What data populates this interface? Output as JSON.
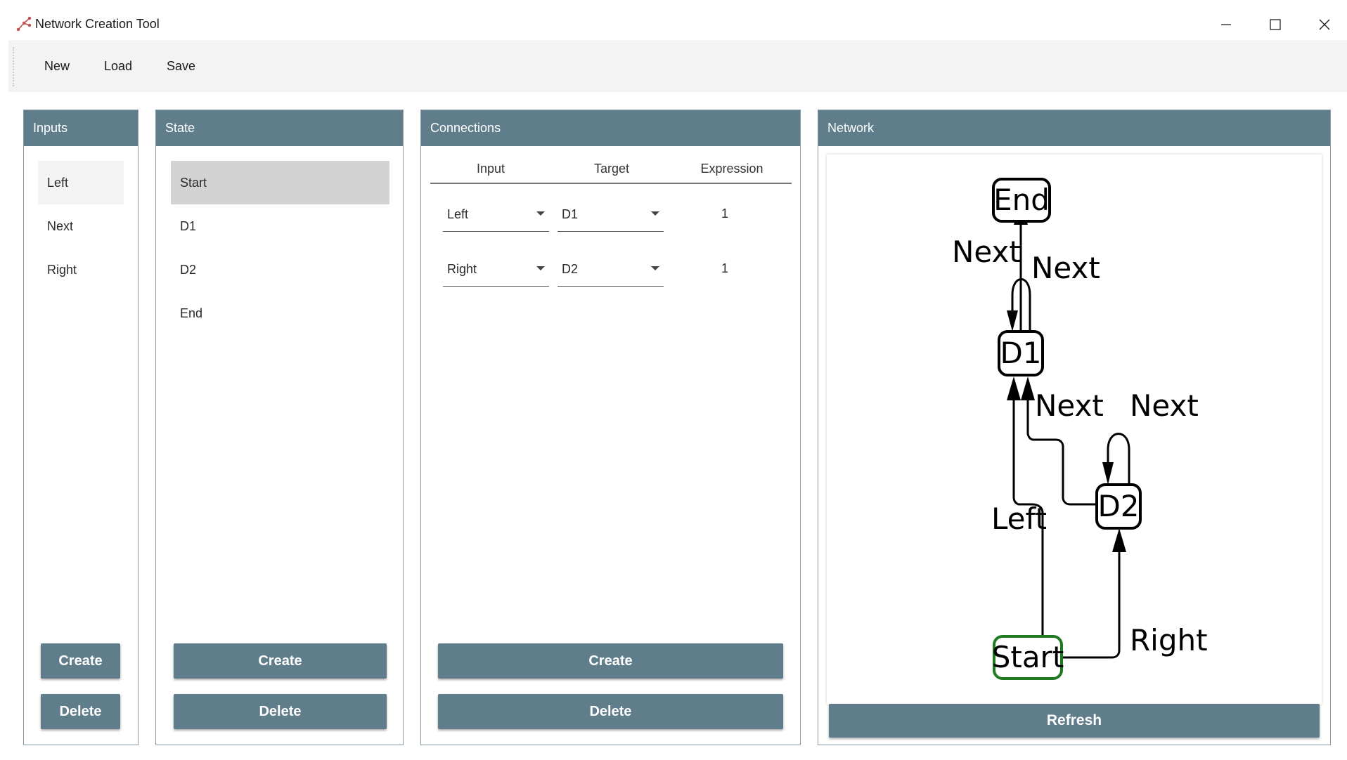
{
  "window": {
    "title": "Network Creation Tool",
    "app_icon": "network-icon",
    "controls": [
      "minimize-icon",
      "maximize-icon",
      "close-icon"
    ]
  },
  "menu": {
    "items": [
      "New",
      "Load",
      "Save"
    ]
  },
  "inputs_panel": {
    "title": "Inputs",
    "items": [
      "Left",
      "Next",
      "Right"
    ],
    "create_label": "Create",
    "delete_label": "Delete"
  },
  "state_panel": {
    "title": "State",
    "items": [
      "Start",
      "D1",
      "D2",
      "End"
    ],
    "selected": "Start",
    "create_label": "Create",
    "delete_label": "Delete"
  },
  "connections_panel": {
    "title": "Connections",
    "columns": [
      "Input",
      "Target",
      "Expression"
    ],
    "rows": [
      {
        "input": "Left",
        "target": "D1",
        "expression": "1"
      },
      {
        "input": "Right",
        "target": "D2",
        "expression": "1"
      }
    ],
    "create_label": "Create",
    "delete_label": "Delete"
  },
  "network_panel": {
    "title": "Network",
    "refresh_label": "Refresh",
    "graph": {
      "nodes": [
        {
          "id": "End",
          "label": "End"
        },
        {
          "id": "D1",
          "label": "D1"
        },
        {
          "id": "D2",
          "label": "D2"
        },
        {
          "id": "Start",
          "label": "Start",
          "initial": true
        }
      ],
      "edges": [
        {
          "from": "D1",
          "to": "End",
          "label": "Next"
        },
        {
          "from": "End",
          "to": "D1",
          "label": "Next"
        },
        {
          "from": "D2",
          "to": "D1",
          "label": "Next"
        },
        {
          "from": "D2",
          "to": "D2",
          "label": "Next"
        },
        {
          "from": "Start",
          "to": "D1",
          "label": "Left"
        },
        {
          "from": "Start",
          "to": "D2",
          "label": "Right"
        }
      ],
      "start_node_color": "#1f7a1f"
    }
  },
  "colors": {
    "accent": "#607d8b",
    "selected": "#d3d3d3"
  }
}
